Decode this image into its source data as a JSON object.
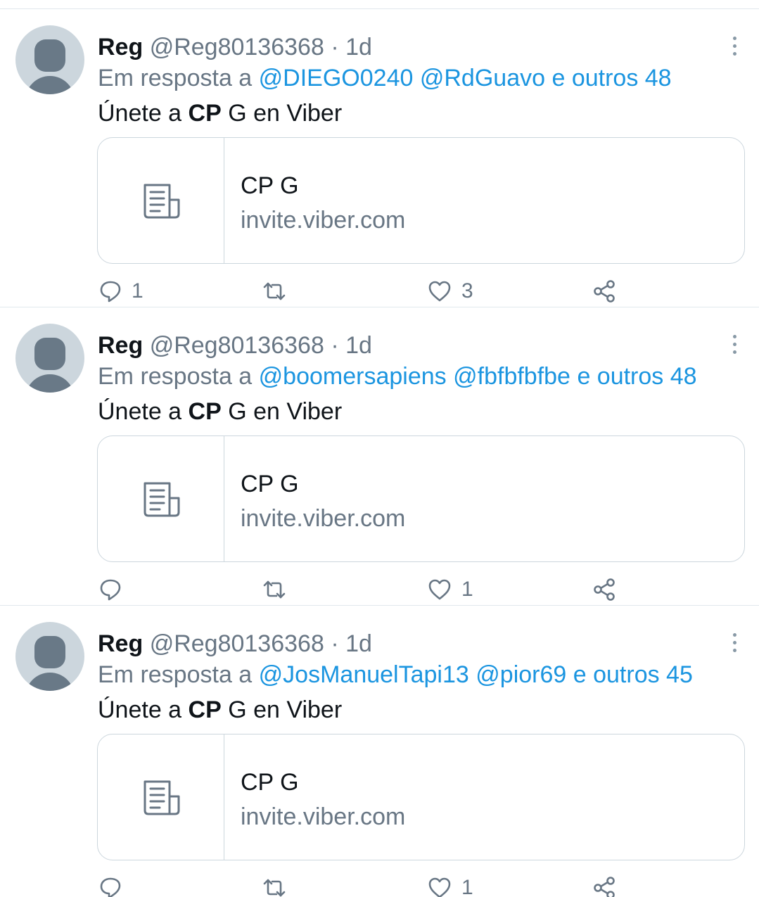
{
  "tweets": [
    {
      "name": "Reg",
      "handle": "@Reg80136368",
      "separator": "·",
      "time": "1d",
      "reply_prefix": "Em resposta a",
      "reply_mention_1": "@DIEGO0240",
      "reply_mention_2": "@RdGuavo",
      "reply_others": "e outros 48",
      "text_before": "Únete a",
      "text_bold": "CP",
      "text_after": "G en Viber",
      "card_title": "CP G",
      "card_domain": "invite.viber.com",
      "replies": "1",
      "retweets": "",
      "likes": "3"
    },
    {
      "name": "Reg",
      "handle": "@Reg80136368",
      "separator": "·",
      "time": "1d",
      "reply_prefix": "Em resposta a",
      "reply_mention_1": "@boomersapiens",
      "reply_mention_2": "@fbfbfbfbe",
      "reply_others": "e outros 48",
      "text_before": "Únete a",
      "text_bold": "CP",
      "text_after": "G en Viber",
      "card_title": "CP G",
      "card_domain": "invite.viber.com",
      "replies": "",
      "retweets": "",
      "likes": "1"
    },
    {
      "name": "Reg",
      "handle": "@Reg80136368",
      "separator": "·",
      "time": "1d",
      "reply_prefix": "Em resposta a",
      "reply_mention_1": "@JosManuelTapi13",
      "reply_mention_2": "@pior69",
      "reply_others": "e outros 45",
      "text_before": "Únete a",
      "text_bold": "CP",
      "text_after": "G en Viber",
      "card_title": "CP G",
      "card_domain": "invite.viber.com",
      "replies": "",
      "retweets": "",
      "likes": "1"
    }
  ],
  "icons": {
    "more": "more-vertical-icon",
    "card": "article-icon",
    "reply": "reply-icon",
    "retweet": "retweet-icon",
    "like": "heart-icon",
    "share": "share-icon"
  },
  "colors": {
    "link": "#1b95e0",
    "secondary_text": "#687684",
    "divider": "#e1e8ed",
    "avatar_bg": "#ccd6dd",
    "avatar_fg": "#697987"
  }
}
